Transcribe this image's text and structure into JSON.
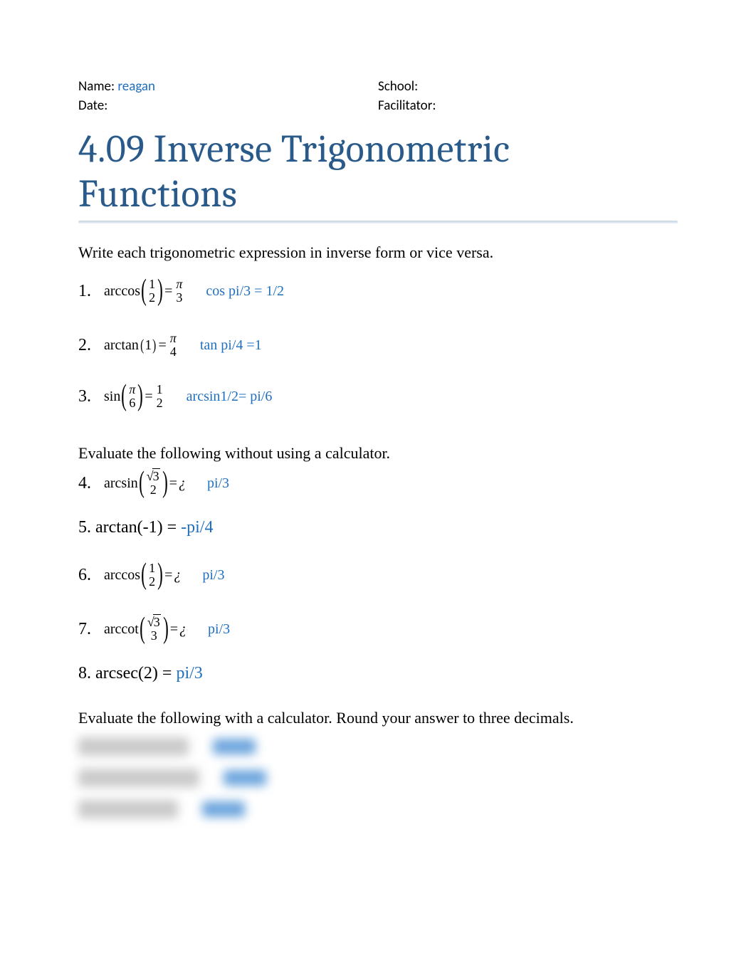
{
  "header": {
    "name_label": "Name:",
    "name_value": "reagan",
    "date_label": "Date:",
    "school_label": "School:",
    "facilitator_label": "Facilitator:"
  },
  "title": "4.09 Inverse Trigonometric Functions",
  "instructions": {
    "a": "Write each trigonometric expression in inverse form or vice versa.",
    "b": "Evaluate the following without using a calculator.",
    "c": "Evaluate the following with a calculator. Round your answer to three decimals."
  },
  "q1": {
    "num": "1.",
    "func": "arccos",
    "arg_num": "1",
    "arg_den": "2",
    "eq": "=",
    "res_num": "π",
    "res_den": "3",
    "answer": "cos pi/3 = 1/2"
  },
  "q2": {
    "num": "2.",
    "func": "arctan",
    "arg": "1",
    "eq": "=",
    "res_num": "π",
    "res_den": "4",
    "answer": "tan pi/4 =1"
  },
  "q3": {
    "num": "3.",
    "func": "sin",
    "arg_num": "π",
    "arg_den": "6",
    "eq": "=",
    "res_num": "1",
    "res_den": "2",
    "answer": "arcsin1/2= pi/6"
  },
  "q4": {
    "num": "4.",
    "func": "arcsin",
    "arg_num_rad": "3",
    "arg_den": "2",
    "eq": "=",
    "res": "¿",
    "answer": "pi/3"
  },
  "q5": {
    "text_left": "5. arctan(-1) = ",
    "answer": "-pi/4"
  },
  "q6": {
    "num": "6.",
    "func": "arccos",
    "arg_num": "1",
    "arg_den": "2",
    "eq": "=",
    "res": "¿",
    "answer": "pi/3"
  },
  "q7": {
    "num": "7.",
    "func": "arccot",
    "arg_num_rad": "3",
    "arg_den": "3",
    "eq": "=",
    "res": "¿",
    "answer": "pi/3"
  },
  "q8": {
    "text_left": "8. arcsec(2) = ",
    "answer": "pi/3"
  }
}
